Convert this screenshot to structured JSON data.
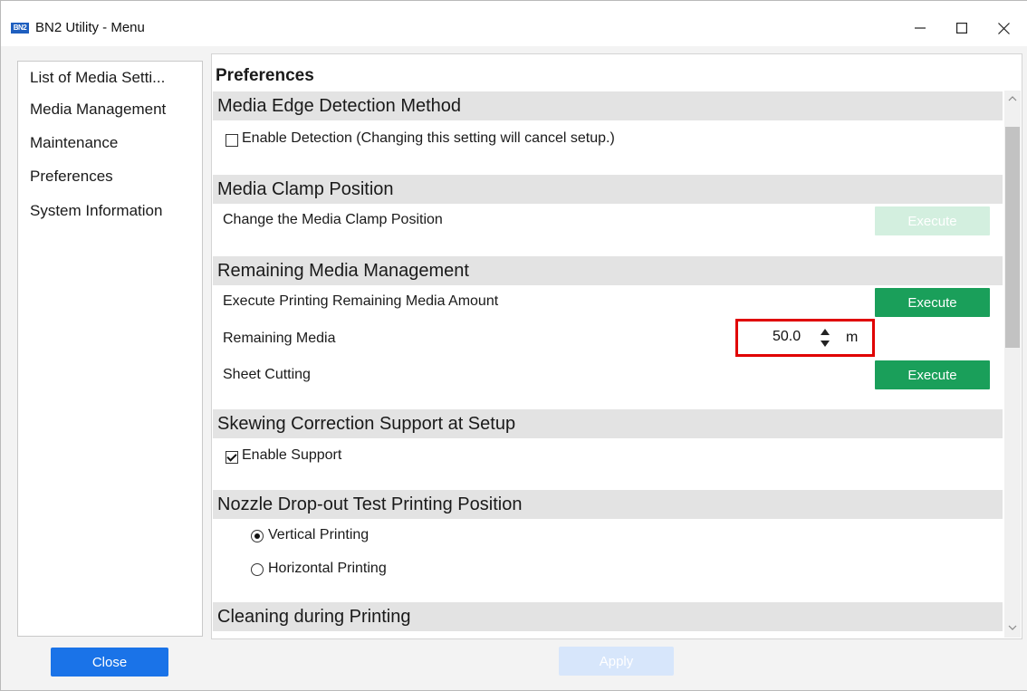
{
  "window": {
    "icon_text": "BN2",
    "title": "BN2 Utility - Menu",
    "controls": [
      "minimize-icon",
      "maximize-icon",
      "close-icon"
    ]
  },
  "sidebar": {
    "items": [
      {
        "label": "List of Media Setti..."
      },
      {
        "label": "Media Management"
      },
      {
        "label": "Maintenance"
      },
      {
        "label": "Preferences"
      },
      {
        "label": "System Information"
      }
    ],
    "close_label": "Close"
  },
  "content": {
    "title": "Preferences",
    "sections": {
      "edge_detection": {
        "header": "Media Edge Detection Method",
        "checkbox_label": "Enable Detection (Changing this setting will cancel setup.)",
        "checked": false
      },
      "clamp_position": {
        "header": "Media Clamp Position",
        "row_label": "Change the Media Clamp Position",
        "button_label": "Execute",
        "button_enabled": false
      },
      "remaining_media": {
        "header": "Remaining Media Management",
        "print_row_label": "Execute Printing Remaining Media Amount",
        "print_button_label": "Execute",
        "remaining_label": "Remaining Media",
        "remaining_value": "50.0",
        "remaining_unit": "m",
        "sheet_cutting_label": "Sheet Cutting",
        "sheet_cutting_button_label": "Execute"
      },
      "skewing": {
        "header": "Skewing Correction Support at Setup",
        "checkbox_label": "Enable Support",
        "checked": true
      },
      "nozzle_test": {
        "header": "Nozzle Drop-out Test Printing Position",
        "options": [
          {
            "label": "Vertical Printing",
            "selected": true
          },
          {
            "label": "Horizontal Printing",
            "selected": false
          }
        ]
      },
      "cleaning": {
        "header": "Cleaning during Printing"
      }
    },
    "apply_label": "Apply"
  },
  "colors": {
    "accent_blue": "#1a73e8",
    "execute_green": "#1a9f5a",
    "highlight_red": "#e00000",
    "section_header_bg": "#e3e3e3"
  }
}
